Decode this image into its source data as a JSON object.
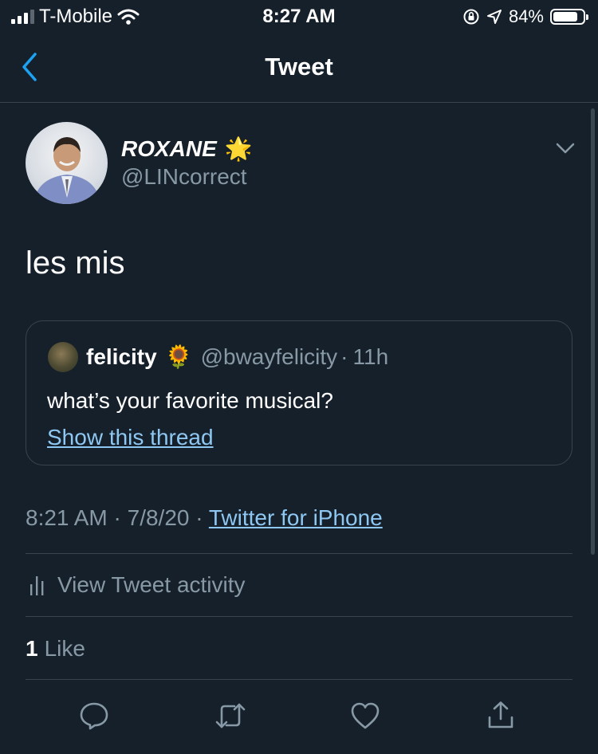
{
  "status_bar": {
    "carrier": "T-Mobile",
    "time": "8:27 AM",
    "battery_text": "84%",
    "battery_level": 0.84
  },
  "nav": {
    "title": "Tweet"
  },
  "tweet": {
    "author_name": "ROXANE",
    "author_emoji": "🌟",
    "author_handle": "@LINcorrect",
    "text": "les mis",
    "quote": {
      "name": "felicity",
      "emoji": "🌻",
      "handle": "@bwayfelicity",
      "separator": "·",
      "age": "11h",
      "text": "what’s your favorite musical?",
      "thread_link": "Show this thread"
    },
    "time": "8:21 AM",
    "date": "7/8/20",
    "separator": "·",
    "source": "Twitter for iPhone"
  },
  "activity": {
    "label": "View Tweet activity"
  },
  "likes": {
    "count": "1",
    "label": "Like"
  },
  "icons": {
    "back": "chevron-left-icon",
    "more": "chevron-down-icon",
    "activity": "bar-chart-icon",
    "reply": "reply-icon",
    "retweet": "retweet-icon",
    "like": "heart-icon",
    "share": "share-icon"
  },
  "colors": {
    "background": "#15202b",
    "accent": "#1da1f2",
    "link": "#8ec7f2",
    "secondary_text": "#8899a6",
    "divider": "#38444d"
  }
}
